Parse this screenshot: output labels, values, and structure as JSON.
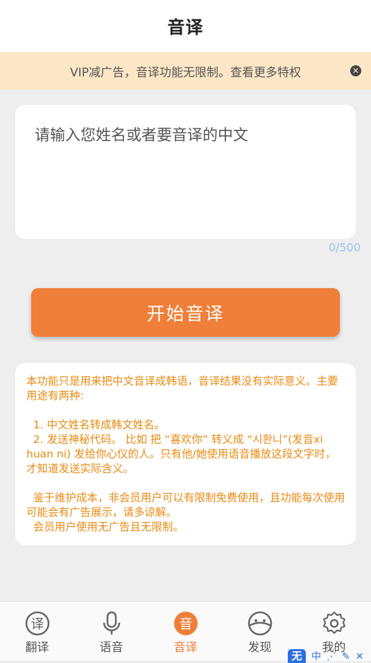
{
  "header": {
    "title": "音译"
  },
  "banner": {
    "text": "VIP减广告，音译功能无限制。查看更多特权",
    "close_icon": "close-icon"
  },
  "input": {
    "placeholder": "请输入您姓名或者要音译的中文",
    "value": "",
    "counter": "0/500"
  },
  "start_button": {
    "label": "开始音译"
  },
  "description": {
    "lines": [
      "本功能只是用来把中文音译成韩语，音译结果没有实际意义。主要用途有两种:",
      "",
      "  1. 中文姓名转成韩文姓名。",
      "  2. 发送神秘代码。 比如 把 “喜欢你” 转义成 “시환니”(发音xi huan ni) 发给你心仪的人。只有他/她使用语音播放这段文字时，才知道发送实际含义。",
      "",
      "  鉴于维护成本，非会员用户可以有限制免费使用，且功能每次使用可能会有广告展示，请多谅解。",
      "  会员用户使用无广告且无限制。"
    ]
  },
  "tabs": [
    {
      "label": "翻译",
      "icon": "translate-icon",
      "glyph": "译",
      "active": false
    },
    {
      "label": "语音",
      "icon": "microphone-icon",
      "active": false
    },
    {
      "label": "音译",
      "icon": "transliterate-icon",
      "glyph": "音",
      "active": true
    },
    {
      "label": "发现",
      "icon": "discover-icon",
      "active": false
    },
    {
      "label": "我的",
      "icon": "settings-icon",
      "active": false
    }
  ],
  "ime_bar": {
    "logo": "无",
    "items": [
      "中",
      "⋰",
      "✎",
      "✕"
    ]
  },
  "colors": {
    "accent": "#ef7f39",
    "banner_bg": "#fbe6c6",
    "desc_text": "#e98a12",
    "counter": "#9cc4ef"
  }
}
